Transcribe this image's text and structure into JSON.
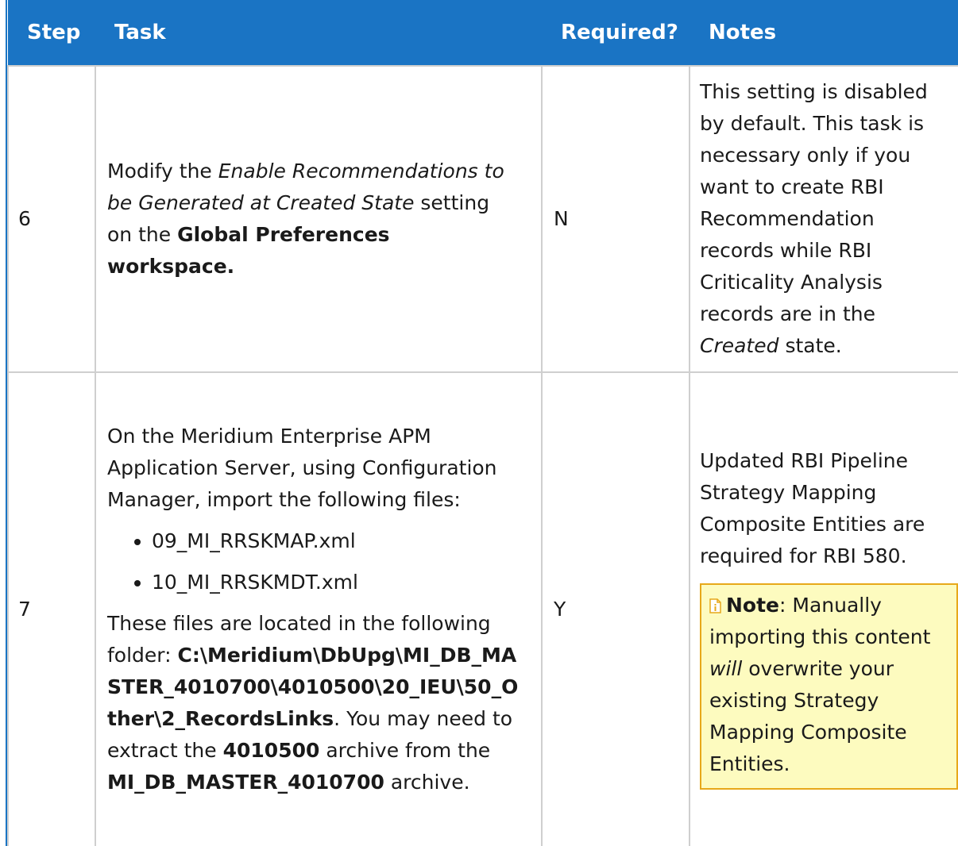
{
  "headers": {
    "step": "Step",
    "task": "Task",
    "required": "Required?",
    "notes": "Notes"
  },
  "row6": {
    "step": "6",
    "task_pre": "Modify the ",
    "task_setting": "Enable Recommendations to be Generated at Created State",
    "task_mid": " setting on the ",
    "task_workspace": "Global Preferences workspace.",
    "required": "N",
    "notes_pre": "This setting is disabled by default. This task is necessary only if you want to create RBI Recommendation records while RBI Criticality Analysis records are in the ",
    "notes_state": "Created",
    "notes_post": " state."
  },
  "row7": {
    "step": "7",
    "task_intro": "On the Meridium Enterprise APM Application Server, using Configuration Manager, import the following files:",
    "files": [
      "09_MI_RRSKMAP.xml",
      "10_MI_RRSKMDT.xml"
    ],
    "located_pre": "These files are located in the following folder: ",
    "folder_path": "C:\\Meridium\\DbUpg\\MI_DB_MASTER_4010700\\4010500\\20_IEU\\50_Other\\2_RecordsLinks",
    "located_mid": ". You may need to extract the ",
    "archive_inner": "4010500",
    "located_mid2": " archive from the ",
    "archive_outer": "MI_DB_MASTER_4010700",
    "located_post": " archive.",
    "required": "Y",
    "notes_text": "Updated RBI Pipeline Strategy Mapping Composite Entities are required for RBI 580.",
    "note_label": "Note",
    "note_pre": ": Manually importing this content ",
    "note_will": "will",
    "note_post": " overwrite your existing Strategy Mapping Composite Entities.",
    "note_icon": "note-icon"
  },
  "colors": {
    "header_bg": "#1a74c4",
    "note_bg": "#fdfbbf",
    "note_border": "#e7a81a"
  }
}
